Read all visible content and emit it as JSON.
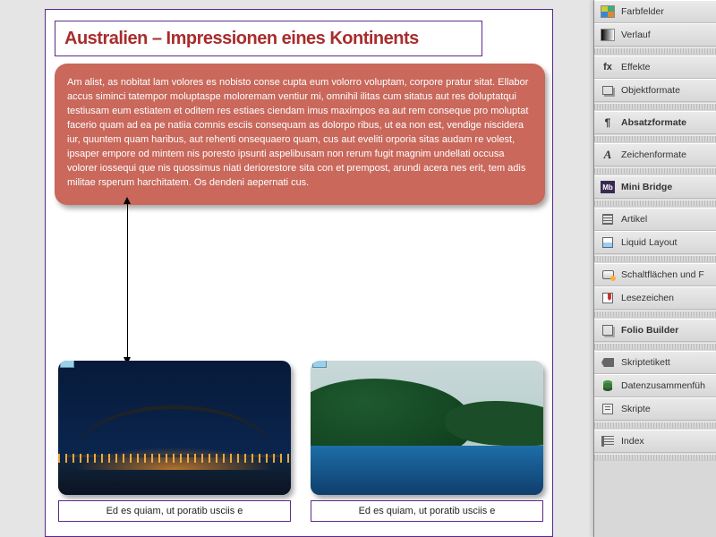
{
  "document": {
    "title": "Australien – Impressionen eines Kontinents",
    "intro": "Am alist, as nobitat lam volores es nobisto conse cupta eum volorro voluptam, corpore pratur sitat. Ellabor accus siminci tatempor moluptaspe moloremam ventiur mi, omnihil ilitas cum sitatus aut res doluptatqui testiusam eum estiatem et oditem res estiaes ciendam imus maximpos ea aut rem conseque pro moluptat facerio quam ad ea pe natiia comnis esciis consequam as dolorpo ribus, ut ea non est, vendige niscidera iur, quuntem quam haribus, aut rehenti onsequaero quam, cus aut eveliti orporia sitas audam re volest, ipsaper empore od mintem nis poresto ipsunti aspelibusam non rerum fugit magnim undellati occusa volorer iossequi que nis quossimus niati deriorestore sita con et prempost, arundi acera nes erit, tem adis militae rsperum harchitatem. Os dendeni aepernati cus.",
    "caption1": "Ed es quiam, ut poratib usciis e",
    "caption2": "Ed es quiam, ut poratib usciis e"
  },
  "panels": {
    "items": [
      {
        "label": "Farbfelder",
        "icon": "i-swatches",
        "bold": false
      },
      {
        "label": "Verlauf",
        "icon": "i-gradient",
        "bold": false
      }
    ],
    "items2": [
      {
        "label": "Effekte",
        "fx": "fx",
        "bold": false
      },
      {
        "label": "Objektformate",
        "icon": "i-obj",
        "bold": false
      }
    ],
    "items3": [
      {
        "label": "Absatzformate",
        "para": "¶",
        "bold": true
      }
    ],
    "items4": [
      {
        "label": "Zeichenformate",
        "char": "A",
        "bold": false
      }
    ],
    "items5": [
      {
        "label": "Mini Bridge",
        "mb": "Mb",
        "bold": true
      }
    ],
    "items6": [
      {
        "label": "Artikel",
        "icon": "i-article",
        "bold": false
      },
      {
        "label": "Liquid Layout",
        "icon": "i-liquid",
        "bold": false
      }
    ],
    "items7": [
      {
        "label": "Schaltflächen und F",
        "icon": "i-btn",
        "bold": false
      },
      {
        "label": "Lesezeichen",
        "icon": "i-bookmark",
        "bold": false
      }
    ],
    "items8": [
      {
        "label": "Folio Builder",
        "icon": "i-folio",
        "bold": true
      }
    ],
    "items9": [
      {
        "label": "Skriptetikett",
        "icon": "i-tag",
        "bold": false
      },
      {
        "label": "Datenzusammenfüh",
        "icon": "i-db",
        "bold": false
      },
      {
        "label": "Skripte",
        "icon": "i-script",
        "bold": false
      }
    ],
    "items10": [
      {
        "label": "Index",
        "icon": "i-index",
        "bold": false
      }
    ]
  }
}
